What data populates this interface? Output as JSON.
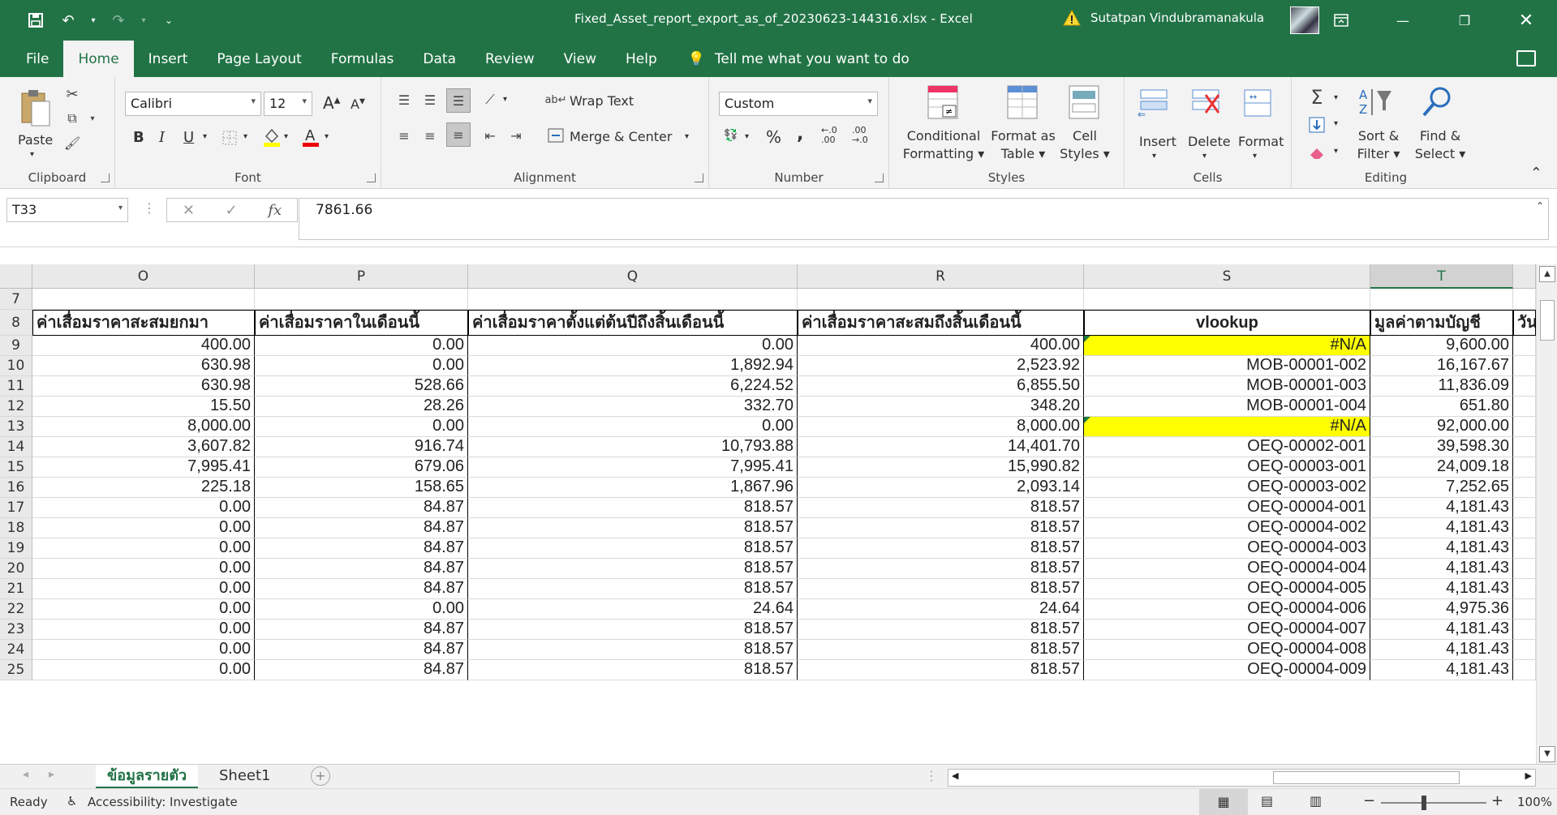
{
  "window": {
    "title": "Fixed_Asset_report_export_as_of_20230623-144316.xlsx  -  Excel",
    "user": "Sutatpan Vindubramanakula"
  },
  "ribbon_tabs": [
    "File",
    "Home",
    "Insert",
    "Page Layout",
    "Formulas",
    "Data",
    "Review",
    "View",
    "Help"
  ],
  "tell_me": "Tell me what you want to do",
  "clipboard": {
    "paste": "Paste",
    "label": "Clipboard"
  },
  "font": {
    "name": "Calibri",
    "size": "12",
    "label": "Font"
  },
  "alignment": {
    "wrap": "Wrap Text",
    "merge": "Merge & Center",
    "label": "Alignment"
  },
  "number": {
    "format": "Custom",
    "label": "Number",
    "percent": "%",
    "comma": ","
  },
  "styles": {
    "cond1": "Conditional",
    "cond2": "Formatting",
    "fmt1": "Format as",
    "fmt2": "Table",
    "cell1": "Cell",
    "cell2": "Styles",
    "label": "Styles"
  },
  "cells": {
    "insert": "Insert",
    "delete": "Delete",
    "format": "Format",
    "label": "Cells"
  },
  "editing": {
    "sort1": "Sort &",
    "sort2": "Filter",
    "find1": "Find &",
    "find2": "Select",
    "label": "Editing"
  },
  "formula_bar": {
    "name_box": "T33",
    "value": "7861.66"
  },
  "columns": [
    {
      "id": "O",
      "label": "O",
      "w": 274
    },
    {
      "id": "P",
      "label": "P",
      "w": 263
    },
    {
      "id": "Q",
      "label": "Q",
      "w": 406
    },
    {
      "id": "R",
      "label": "R",
      "w": 353
    },
    {
      "id": "S",
      "label": "S",
      "w": 353
    },
    {
      "id": "T",
      "label": "T",
      "w": 176
    },
    {
      "id": "U",
      "label": "",
      "w": 28
    }
  ],
  "headers": {
    "O": "ค่าเสื่อมราคาสะสมยกมา",
    "P": "ค่าเสื่อมราคาในเดือนนี้",
    "Q": "ค่าเสื่อมราคาตั้งแต่ต้นปีถึงสิ้นเดือนนี้",
    "R": "ค่าเสื่อมราคาสะสมถึงสิ้นเดือนนี้",
    "S": "vlookup",
    "T": "มูลค่าตามบัญชี",
    "U": "วัน"
  },
  "rows": [
    {
      "n": "9",
      "O": "400.00",
      "P": "0.00",
      "Q": "0.00",
      "R": "400.00",
      "S": "#N/A",
      "T": "9,600.00",
      "yellow": true
    },
    {
      "n": "10",
      "O": "630.98",
      "P": "0.00",
      "Q": "1,892.94",
      "R": "2,523.92",
      "S": "MOB-00001-002",
      "T": "16,167.67"
    },
    {
      "n": "11",
      "O": "630.98",
      "P": "528.66",
      "Q": "6,224.52",
      "R": "6,855.50",
      "S": "MOB-00001-003",
      "T": "11,836.09"
    },
    {
      "n": "12",
      "O": "15.50",
      "P": "28.26",
      "Q": "332.70",
      "R": "348.20",
      "S": "MOB-00001-004",
      "T": "651.80"
    },
    {
      "n": "13",
      "O": "8,000.00",
      "P": "0.00",
      "Q": "0.00",
      "R": "8,000.00",
      "S": "#N/A",
      "T": "92,000.00",
      "yellow": true
    },
    {
      "n": "14",
      "O": "3,607.82",
      "P": "916.74",
      "Q": "10,793.88",
      "R": "14,401.70",
      "S": "OEQ-00002-001",
      "T": "39,598.30"
    },
    {
      "n": "15",
      "O": "7,995.41",
      "P": "679.06",
      "Q": "7,995.41",
      "R": "15,990.82",
      "S": "OEQ-00003-001",
      "T": "24,009.18"
    },
    {
      "n": "16",
      "O": "225.18",
      "P": "158.65",
      "Q": "1,867.96",
      "R": "2,093.14",
      "S": "OEQ-00003-002",
      "T": "7,252.65"
    },
    {
      "n": "17",
      "O": "0.00",
      "P": "84.87",
      "Q": "818.57",
      "R": "818.57",
      "S": "OEQ-00004-001",
      "T": "4,181.43"
    },
    {
      "n": "18",
      "O": "0.00",
      "P": "84.87",
      "Q": "818.57",
      "R": "818.57",
      "S": "OEQ-00004-002",
      "T": "4,181.43"
    },
    {
      "n": "19",
      "O": "0.00",
      "P": "84.87",
      "Q": "818.57",
      "R": "818.57",
      "S": "OEQ-00004-003",
      "T": "4,181.43"
    },
    {
      "n": "20",
      "O": "0.00",
      "P": "84.87",
      "Q": "818.57",
      "R": "818.57",
      "S": "OEQ-00004-004",
      "T": "4,181.43"
    },
    {
      "n": "21",
      "O": "0.00",
      "P": "84.87",
      "Q": "818.57",
      "R": "818.57",
      "S": "OEQ-00004-005",
      "T": "4,181.43"
    },
    {
      "n": "22",
      "O": "0.00",
      "P": "0.00",
      "Q": "24.64",
      "R": "24.64",
      "S": "OEQ-00004-006",
      "T": "4,975.36"
    },
    {
      "n": "23",
      "O": "0.00",
      "P": "84.87",
      "Q": "818.57",
      "R": "818.57",
      "S": "OEQ-00004-007",
      "T": "4,181.43"
    },
    {
      "n": "24",
      "O": "0.00",
      "P": "84.87",
      "Q": "818.57",
      "R": "818.57",
      "S": "OEQ-00004-008",
      "T": "4,181.43"
    },
    {
      "n": "25",
      "O": "0.00",
      "P": "84.87",
      "Q": "818.57",
      "R": "818.57",
      "S": "OEQ-00004-009",
      "T": "4,181.43"
    }
  ],
  "row7": "7",
  "row8": "8",
  "sheets": [
    "ข้อมูลรายตัว",
    "Sheet1"
  ],
  "status": {
    "ready": "Ready",
    "accessibility": "Accessibility: Investigate",
    "zoom": "100%"
  }
}
